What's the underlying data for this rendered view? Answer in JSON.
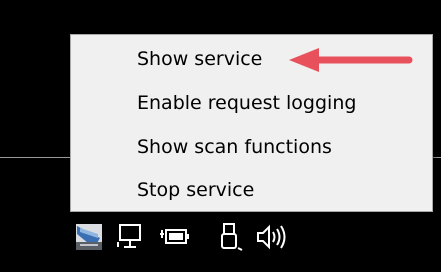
{
  "context_menu": {
    "items": [
      {
        "label": "Show service"
      },
      {
        "label": "Enable request logging"
      },
      {
        "label": "Show scan functions"
      },
      {
        "label": "Stop service"
      }
    ]
  },
  "annotation": {
    "arrow_color": "#e8505b"
  },
  "tray": {
    "icons": [
      {
        "name": "scanner-service-icon"
      },
      {
        "name": "network-icon"
      },
      {
        "name": "battery-icon"
      },
      {
        "name": "usb-device-icon"
      },
      {
        "name": "speaker-icon"
      }
    ]
  }
}
